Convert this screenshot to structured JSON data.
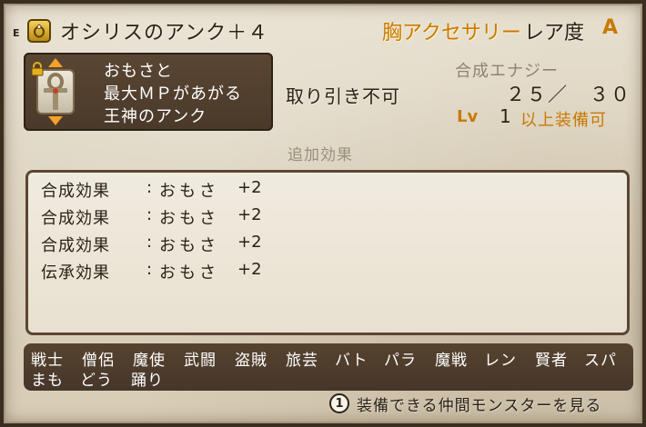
{
  "header": {
    "equip_mark": "E",
    "item_name": "オシリスのアンク＋４",
    "category": "胸アクセサリー",
    "rarity_label": "レア度",
    "rarity_value": "A",
    "item_icon": "ring-icon"
  },
  "description": {
    "lines": [
      "おもさと",
      "最大ＭＰがあがる",
      "王神のアンク"
    ],
    "icon": "ankh-icon",
    "lock_icon": "lock-icon"
  },
  "trade": "取り引き不可",
  "synthesis": {
    "label": "合成エナジー",
    "value": "２５／　３０"
  },
  "level": {
    "label": "Lv",
    "number": "1",
    "text": "以上装備可"
  },
  "extra_effects": {
    "title": "追加効果",
    "rows": [
      {
        "label": "合成効果",
        "colon": ":",
        "value": "おもさ",
        "plus": "+2"
      },
      {
        "label": "合成効果",
        "colon": ":",
        "value": "おもさ",
        "plus": "+2"
      },
      {
        "label": "合成効果",
        "colon": ":",
        "value": "おもさ",
        "plus": "+2"
      },
      {
        "label": "伝承効果",
        "colon": ":",
        "value": "おもさ",
        "plus": "+2"
      }
    ]
  },
  "jobs": {
    "row1": [
      "戦士",
      "僧侶",
      "魔使",
      "武闘",
      "盗賊",
      "旅芸",
      "バト",
      "パラ",
      "魔戦",
      "レン",
      "賢者",
      "スパ"
    ],
    "row2": [
      "まも",
      "どう",
      "踊り"
    ]
  },
  "footer": {
    "button_number": "1",
    "button_label": "装備できる仲間モンスターを見る"
  },
  "colors": {
    "orange": "#c87a05",
    "dark_box": "#4f3d2d",
    "parchment": "#e0d8c5"
  }
}
